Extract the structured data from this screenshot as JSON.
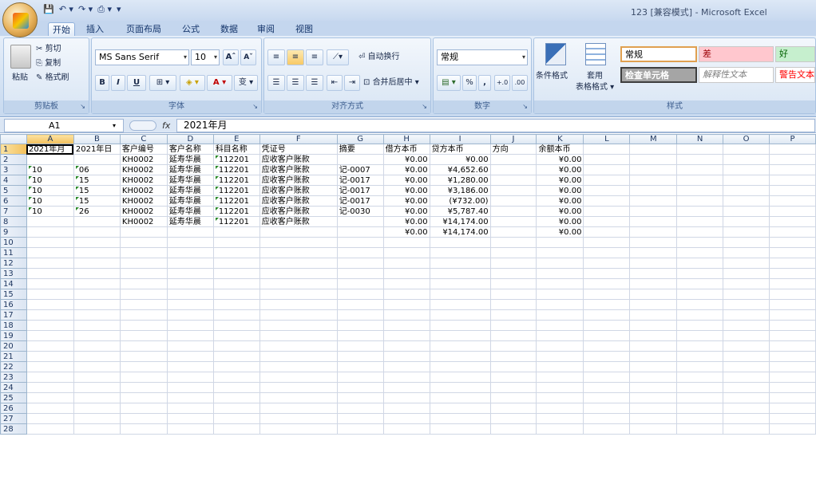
{
  "window": {
    "title": "123 [兼容模式] - Microsoft Excel"
  },
  "quick_access": {
    "save": "💾",
    "undo": "↶ ▾",
    "redo": "↷ ▾",
    "print": "⎙ ▾",
    "customize": "▾"
  },
  "tabs": [
    "开始",
    "插入",
    "页面布局",
    "公式",
    "数据",
    "审阅",
    "视图"
  ],
  "ribbon": {
    "clipboard": {
      "title": "剪贴板",
      "paste": "粘贴",
      "cut": "剪切",
      "copy": "复制",
      "format_painter": "格式刷"
    },
    "font": {
      "title": "字体",
      "font_name": "MS Sans Serif",
      "font_size": "10",
      "grow": "Aˆ",
      "shrink": "Aˇ",
      "bold": "B",
      "italic": "I",
      "underline": "U",
      "border": "⊞ ▾",
      "fill": "◈ ▾",
      "color": "A ▾",
      "phonetic": "变 ▾"
    },
    "alignment": {
      "title": "对齐方式",
      "wrap": "自动换行",
      "merge": "合并后居中 ▾"
    },
    "number": {
      "title": "数字",
      "format": "常规",
      "currency": "▤ ▾",
      "percent": "%",
      "comma": ",",
      "inc": "+.0",
      "dec": ".00"
    },
    "styles": {
      "title": "样式",
      "conditional": "条件格式",
      "table": "套用",
      "table2": "表格格式 ▾",
      "normal": "常规",
      "bad": "差",
      "good": "好",
      "check": "检查单元格",
      "explanatory": "解释性文本",
      "warning": "警告文本"
    }
  },
  "formula_bar": {
    "name_box": "A1",
    "fx": "fx",
    "formula": "2021年月"
  },
  "columns": [
    "A",
    "B",
    "C",
    "D",
    "E",
    "F",
    "G",
    "H",
    "I",
    "J",
    "K",
    "L",
    "M",
    "N",
    "O",
    "P"
  ],
  "rows": [
    [
      "2021年月",
      "2021年日",
      "客户编号",
      "客户名称",
      "科目名称",
      "凭证号",
      "摘要",
      "借方本币",
      "贷方本币",
      "方向",
      "余额本币",
      "",
      "",
      "",
      "",
      ""
    ],
    [
      "",
      "",
      "KH0002",
      "延寿华晨",
      "112201",
      "应收客户账款",
      "",
      "¥0.00",
      "¥0.00",
      "",
      "¥0.00",
      "",
      "",
      "",
      "",
      ""
    ],
    [
      "10",
      "06",
      "KH0002",
      "延寿华晨",
      "112201",
      "应收客户账款",
      "记-0007",
      "¥0.00",
      "¥4,652.60",
      "",
      "¥0.00",
      "",
      "",
      "",
      "",
      ""
    ],
    [
      "10",
      "15",
      "KH0002",
      "延寿华晨",
      "112201",
      "应收客户账款",
      "记-0017",
      "¥0.00",
      "¥1,280.00",
      "",
      "¥0.00",
      "",
      "",
      "",
      "",
      ""
    ],
    [
      "10",
      "15",
      "KH0002",
      "延寿华晨",
      "112201",
      "应收客户账款",
      "记-0017",
      "¥0.00",
      "¥3,186.00",
      "",
      "¥0.00",
      "",
      "",
      "",
      "",
      ""
    ],
    [
      "10",
      "15",
      "KH0002",
      "延寿华晨",
      "112201",
      "应收客户账款",
      "记-0017",
      "¥0.00",
      "(¥732.00)",
      "",
      "¥0.00",
      "",
      "",
      "",
      "",
      ""
    ],
    [
      "10",
      "26",
      "KH0002",
      "延寿华晨",
      "112201",
      "应收客户账款",
      "记-0030",
      "¥0.00",
      "¥5,787.40",
      "",
      "¥0.00",
      "",
      "",
      "",
      "",
      ""
    ],
    [
      "",
      "",
      "KH0002",
      "延寿华晨",
      "112201",
      "应收客户账款",
      "",
      "¥0.00",
      "¥14,174.00",
      "",
      "¥0.00",
      "",
      "",
      "",
      "",
      ""
    ],
    [
      "",
      "",
      "",
      "",
      "",
      "",
      "",
      "¥0.00",
      "¥14,174.00",
      "",
      "¥0.00",
      "",
      "",
      "",
      "",
      ""
    ]
  ],
  "total_rows": 28
}
